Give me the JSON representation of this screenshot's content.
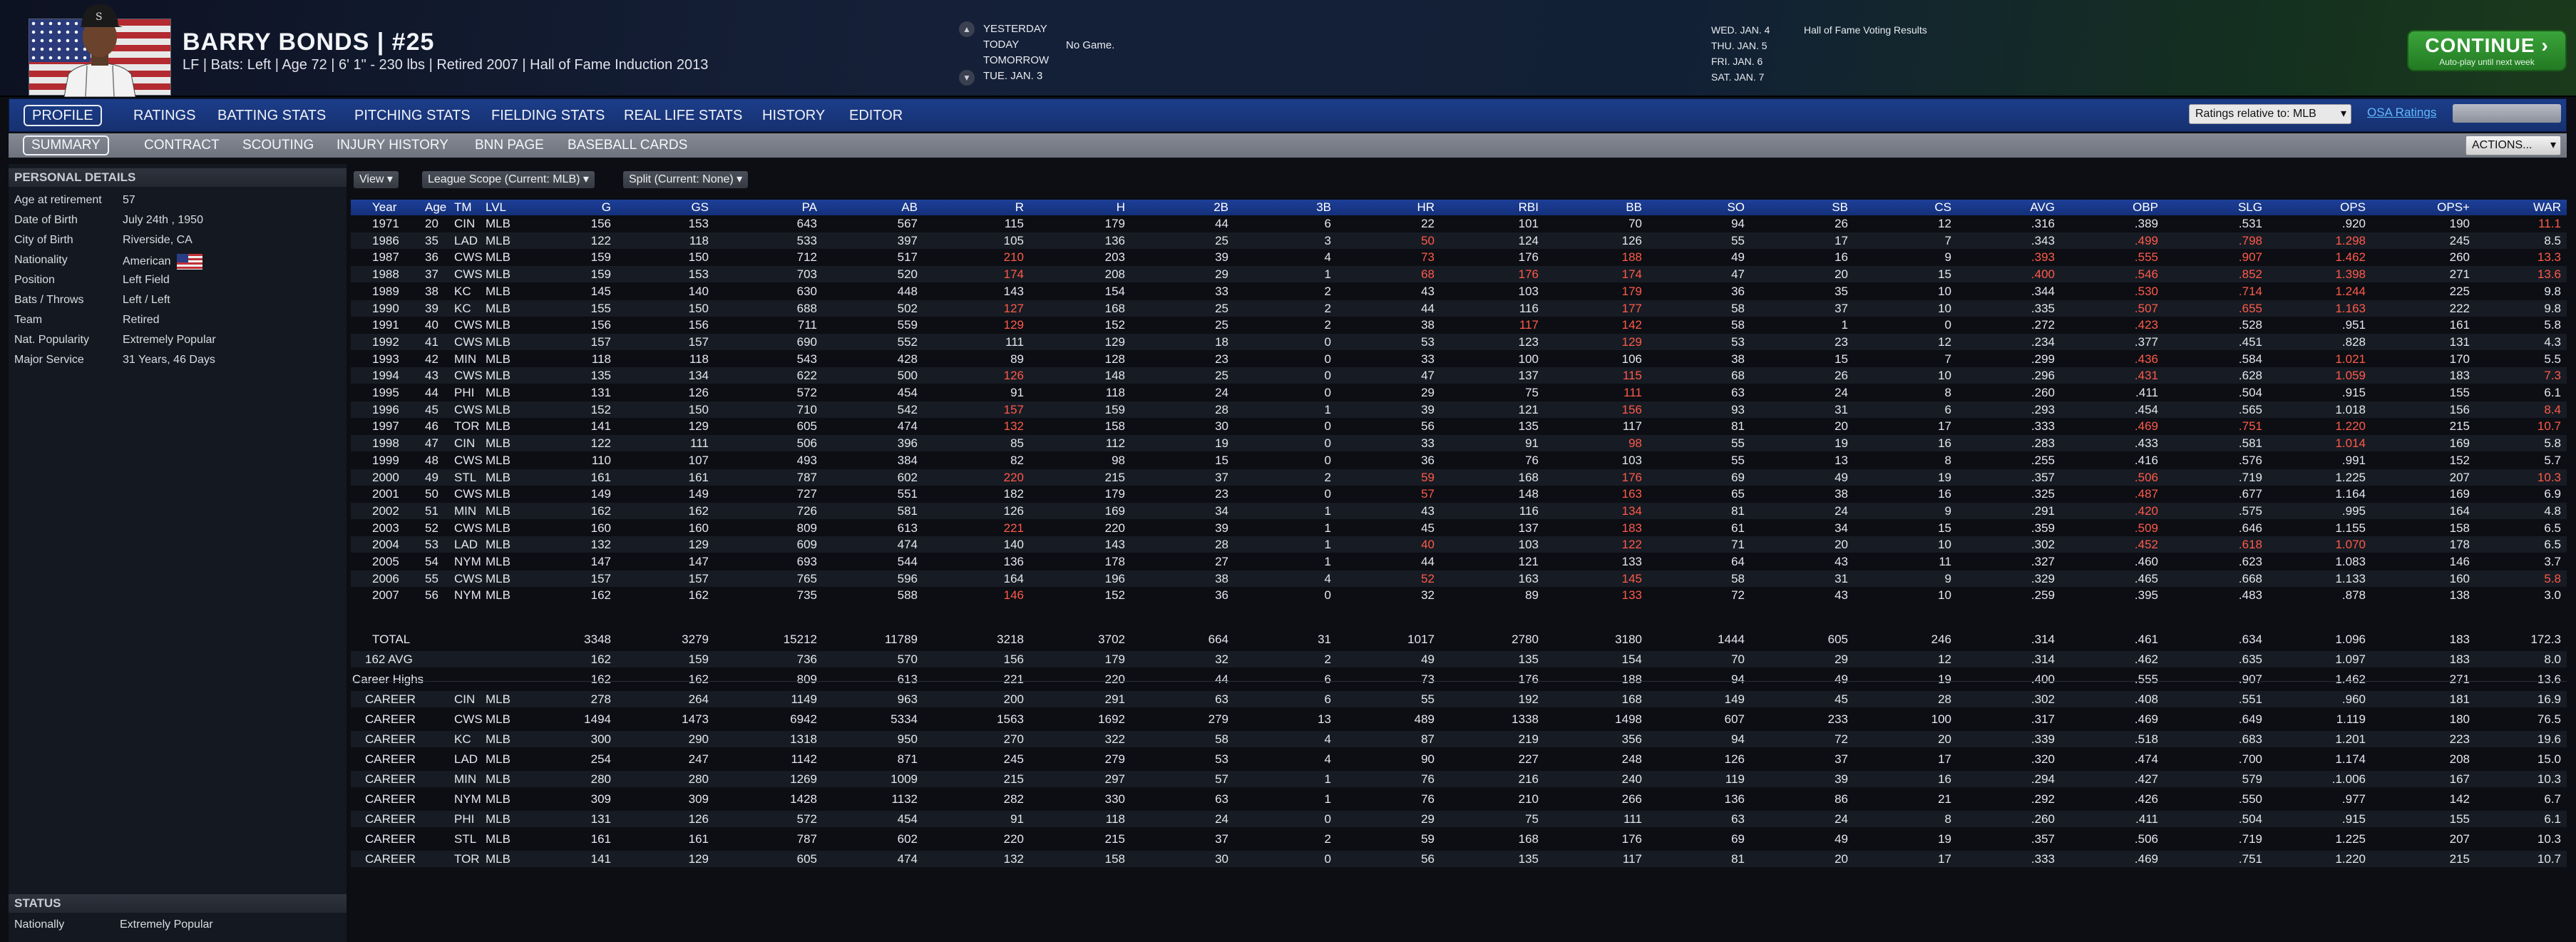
{
  "header": {
    "name_line": "BARRY BONDS  |  #25",
    "sub_line": "LF | Bats: Left  | Age 72  |  6' 1\" - 230 lbs  |  Retired 2007  |  Hall of Fame Induction 2013",
    "days": [
      "YESTERDAY",
      "TODAY",
      "TOMORROW",
      "TUE. JAN. 3"
    ],
    "no_game": "No Game.",
    "calendar": [
      "WED. JAN. 4",
      "THU. JAN. 5",
      "FRI. JAN. 6",
      "SAT. JAN. 7"
    ],
    "calendar_event": "Hall of Fame Voting Results",
    "continue_label": "CONTINUE",
    "continue_sub": "Auto-play until next week"
  },
  "main_nav": [
    "PROFILE",
    "RATINGS",
    "BATTING STATS",
    "PITCHING STATS",
    "FIELDING STATS",
    "REAL LIFE STATS",
    "HISTORY",
    "EDITOR"
  ],
  "ratings_relative": "Ratings relative to: MLB",
  "osa_label": "OSA Ratings",
  "sub_nav": [
    "SUMMARY",
    "CONTRACT",
    "SCOUTING",
    "INJURY HISTORY",
    "BNN PAGE",
    "BASEBALL CARDS"
  ],
  "actions_label": "ACTIONS...",
  "personal": {
    "title": "PERSONAL DETAILS",
    "rows": [
      {
        "k": "Age at retirement",
        "v": "57"
      },
      {
        "k": "Date of Birth",
        "v": "July 24th , 1950"
      },
      {
        "k": "City of Birth",
        "v": "Riverside, CA"
      },
      {
        "k": "Nationality",
        "v": "American"
      },
      {
        "k": "Position",
        "v": "Left Field"
      },
      {
        "k": "Bats / Throws",
        "v": "Left / Left"
      },
      {
        "k": "Team",
        "v": "Retired"
      },
      {
        "k": "Nat. Popularity",
        "v": "Extremely Popular"
      },
      {
        "k": "Major Service",
        "v": "31 Years, 46 Days"
      }
    ]
  },
  "status": {
    "title": "STATUS",
    "rows": [
      {
        "k": "Nationally",
        "v": "Extremely Popular"
      }
    ]
  },
  "filters": [
    "View",
    "League Scope (Current: MLB)",
    "Split  (Current: None)"
  ],
  "columns": [
    "Year",
    "Age",
    "TM",
    "LVL",
    "G",
    "GS",
    "PA",
    "AB",
    "R",
    "H",
    "2B",
    "3B",
    "HR",
    "RBI",
    "BB",
    "SO",
    "SB",
    "CS",
    "AVG",
    "OBP",
    "SLG",
    "OPS",
    "OPS+",
    "WAR"
  ],
  "seasons": [
    [
      "1971",
      "20",
      "CIN",
      "MLB",
      "156",
      "153",
      "643",
      "567",
      "115",
      "179",
      "44",
      "6",
      "22",
      "101",
      "70",
      "94",
      "26",
      "12",
      ".316",
      ".389",
      ".531",
      ".920",
      "190",
      "11.1"
    ],
    [
      "1986",
      "35",
      "LAD",
      "MLB",
      "122",
      "118",
      "533",
      "397",
      "105",
      "136",
      "25",
      "3",
      "50",
      "124",
      "126",
      "55",
      "17",
      "7",
      ".343",
      ".499",
      ".798",
      "1.298",
      "245",
      "8.5"
    ],
    [
      "1987",
      "36",
      "CWS",
      "MLB",
      "159",
      "150",
      "712",
      "517",
      "210",
      "203",
      "39",
      "4",
      "73",
      "176",
      "188",
      "49",
      "16",
      "9",
      ".393",
      ".555",
      ".907",
      "1.462",
      "260",
      "13.3"
    ],
    [
      "1988",
      "37",
      "CWS",
      "MLB",
      "159",
      "153",
      "703",
      "520",
      "174",
      "208",
      "29",
      "1",
      "68",
      "176",
      "174",
      "47",
      "20",
      "15",
      ".400",
      ".546",
      ".852",
      "1.398",
      "271",
      "13.6"
    ],
    [
      "1989",
      "38",
      "KC",
      "MLB",
      "145",
      "140",
      "630",
      "448",
      "143",
      "154",
      "33",
      "2",
      "43",
      "103",
      "179",
      "36",
      "35",
      "10",
      ".344",
      ".530",
      ".714",
      "1.244",
      "225",
      "9.8"
    ],
    [
      "1990",
      "39",
      "KC",
      "MLB",
      "155",
      "150",
      "688",
      "502",
      "127",
      "168",
      "25",
      "2",
      "44",
      "116",
      "177",
      "58",
      "37",
      "10",
      ".335",
      ".507",
      ".655",
      "1.163",
      "222",
      "9.8"
    ],
    [
      "1991",
      "40",
      "CWS",
      "MLB",
      "156",
      "156",
      "711",
      "559",
      "129",
      "152",
      "25",
      "2",
      "38",
      "117",
      "142",
      "58",
      "1",
      "0",
      ".272",
      ".423",
      ".528",
      ".951",
      "161",
      "5.8"
    ],
    [
      "1992",
      "41",
      "CWS",
      "MLB",
      "157",
      "157",
      "690",
      "552",
      "111",
      "129",
      "18",
      "0",
      "53",
      "123",
      "129",
      "53",
      "23",
      "12",
      ".234",
      ".377",
      ".451",
      ".828",
      "131",
      "4.3"
    ],
    [
      "1993",
      "42",
      "MIN",
      "MLB",
      "118",
      "118",
      "543",
      "428",
      "89",
      "128",
      "23",
      "0",
      "33",
      "100",
      "106",
      "38",
      "15",
      "7",
      ".299",
      ".436",
      ".584",
      "1.021",
      "170",
      "5.5"
    ],
    [
      "1994",
      "43",
      "CWS",
      "MLB",
      "135",
      "134",
      "622",
      "500",
      "126",
      "148",
      "25",
      "0",
      "47",
      "137",
      "115",
      "68",
      "26",
      "10",
      ".296",
      ".431",
      ".628",
      "1.059",
      "183",
      "7.3"
    ],
    [
      "1995",
      "44",
      "PHI",
      "MLB",
      "131",
      "126",
      "572",
      "454",
      "91",
      "118",
      "24",
      "0",
      "29",
      "75",
      "111",
      "63",
      "24",
      "8",
      ".260",
      ".411",
      ".504",
      ".915",
      "155",
      "6.1"
    ],
    [
      "1996",
      "45",
      "CWS",
      "MLB",
      "152",
      "150",
      "710",
      "542",
      "157",
      "159",
      "28",
      "1",
      "39",
      "121",
      "156",
      "93",
      "31",
      "6",
      ".293",
      ".454",
      ".565",
      "1.018",
      "156",
      "8.4"
    ],
    [
      "1997",
      "46",
      "TOR",
      "MLB",
      "141",
      "129",
      "605",
      "474",
      "132",
      "158",
      "30",
      "0",
      "56",
      "135",
      "117",
      "81",
      "20",
      "17",
      ".333",
      ".469",
      ".751",
      "1.220",
      "215",
      "10.7"
    ],
    [
      "1998",
      "47",
      "CIN",
      "MLB",
      "122",
      "111",
      "506",
      "396",
      "85",
      "112",
      "19",
      "0",
      "33",
      "91",
      "98",
      "55",
      "19",
      "16",
      ".283",
      ".433",
      ".581",
      "1.014",
      "169",
      "5.8"
    ],
    [
      "1999",
      "48",
      "CWS",
      "MLB",
      "110",
      "107",
      "493",
      "384",
      "82",
      "98",
      "15",
      "0",
      "36",
      "76",
      "103",
      "55",
      "13",
      "8",
      ".255",
      ".416",
      ".576",
      ".991",
      "152",
      "5.7"
    ],
    [
      "2000",
      "49",
      "STL",
      "MLB",
      "161",
      "161",
      "787",
      "602",
      "220",
      "215",
      "37",
      "2",
      "59",
      "168",
      "176",
      "69",
      "49",
      "19",
      ".357",
      ".506",
      ".719",
      "1.225",
      "207",
      "10.3"
    ],
    [
      "2001",
      "50",
      "CWS",
      "MLB",
      "149",
      "149",
      "727",
      "551",
      "182",
      "179",
      "23",
      "0",
      "57",
      "148",
      "163",
      "65",
      "38",
      "16",
      ".325",
      ".487",
      ".677",
      "1.164",
      "169",
      "6.9"
    ],
    [
      "2002",
      "51",
      "MIN",
      "MLB",
      "162",
      "162",
      "726",
      "581",
      "126",
      "169",
      "34",
      "1",
      "43",
      "116",
      "134",
      "81",
      "24",
      "9",
      ".291",
      ".420",
      ".575",
      ".995",
      "164",
      "4.8"
    ],
    [
      "2003",
      "52",
      "CWS",
      "MLB",
      "160",
      "160",
      "809",
      "613",
      "221",
      "220",
      "39",
      "1",
      "45",
      "137",
      "183",
      "61",
      "34",
      "15",
      ".359",
      ".509",
      ".646",
      "1.155",
      "158",
      "6.5"
    ],
    [
      "2004",
      "53",
      "LAD",
      "MLB",
      "132",
      "129",
      "609",
      "474",
      "140",
      "143",
      "28",
      "1",
      "40",
      "103",
      "122",
      "71",
      "20",
      "10",
      ".302",
      ".452",
      ".618",
      "1.070",
      "178",
      "6.5"
    ],
    [
      "2005",
      "54",
      "NYM",
      "MLB",
      "147",
      "147",
      "693",
      "544",
      "136",
      "178",
      "27",
      "1",
      "44",
      "121",
      "133",
      "64",
      "43",
      "11",
      ".327",
      ".460",
      ".623",
      "1.083",
      "146",
      "3.7"
    ],
    [
      "2006",
      "55",
      "CWS",
      "MLB",
      "157",
      "157",
      "765",
      "596",
      "164",
      "196",
      "38",
      "4",
      "52",
      "163",
      "145",
      "58",
      "31",
      "9",
      ".329",
      ".465",
      ".668",
      "1.133",
      "160",
      "5.8"
    ],
    [
      "2007",
      "56",
      "NYM",
      "MLB",
      "162",
      "162",
      "735",
      "588",
      "146",
      "152",
      "36",
      "0",
      "32",
      "89",
      "133",
      "72",
      "43",
      "10",
      ".259",
      ".395",
      ".483",
      ".878",
      "138",
      "3.0"
    ]
  ],
  "totals": [
    [
      "TOTAL",
      "",
      "",
      "",
      "3348",
      "3279",
      "15212",
      "11789",
      "3218",
      "3702",
      "664",
      "31",
      "1017",
      "2780",
      "3180",
      "1444",
      "605",
      "246",
      ".314",
      ".461",
      ".634",
      "1.096",
      "183",
      "172.3"
    ],
    [
      "162 AVG",
      "",
      "",
      "",
      "162",
      "159",
      "736",
      "570",
      "156",
      "179",
      "32",
      "2",
      "49",
      "135",
      "154",
      "70",
      "29",
      "12",
      ".314",
      ".462",
      ".635",
      "1.097",
      "183",
      "8.0"
    ],
    [
      "Career Highs",
      "",
      "",
      "",
      "162",
      "162",
      "809",
      "613",
      "221",
      "220",
      "44",
      "6",
      "73",
      "176",
      "188",
      "94",
      "49",
      "19",
      ".400",
      ".555",
      ".907",
      "1.462",
      "271",
      "13.6"
    ],
    [
      "CAREER",
      "",
      "CIN",
      "MLB",
      "278",
      "264",
      "1149",
      "963",
      "200",
      "291",
      "63",
      "6",
      "55",
      "192",
      "168",
      "149",
      "45",
      "28",
      ".302",
      ".408",
      ".551",
      ".960",
      "181",
      "16.9"
    ],
    [
      "CAREER",
      "",
      "CWS",
      "MLB",
      "1494",
      "1473",
      "6942",
      "5334",
      "1563",
      "1692",
      "279",
      "13",
      "489",
      "1338",
      "1498",
      "607",
      "233",
      "100",
      ".317",
      ".469",
      ".649",
      "1.119",
      "180",
      "76.5"
    ],
    [
      "CAREER",
      "",
      "KC",
      "MLB",
      "300",
      "290",
      "1318",
      "950",
      "270",
      "322",
      "58",
      "4",
      "87",
      "219",
      "356",
      "94",
      "72",
      "20",
      ".339",
      ".518",
      ".683",
      "1.201",
      "223",
      "19.6"
    ],
    [
      "CAREER",
      "",
      "LAD",
      "MLB",
      "254",
      "247",
      "1142",
      "871",
      "245",
      "279",
      "53",
      "4",
      "90",
      "227",
      "248",
      "126",
      "37",
      "17",
      ".320",
      ".474",
      ".700",
      "1.174",
      "208",
      "15.0"
    ],
    [
      "CAREER",
      "",
      "MIN",
      "MLB",
      "280",
      "280",
      "1269",
      "1009",
      "215",
      "297",
      "57",
      "1",
      "76",
      "216",
      "240",
      "119",
      "39",
      "16",
      ".294",
      ".427",
      "579",
      ".1.006",
      "167",
      "10.3"
    ],
    [
      "CAREER",
      "",
      "NYM",
      "MLB",
      "309",
      "309",
      "1428",
      "1132",
      "282",
      "330",
      "63",
      "1",
      "76",
      "210",
      "266",
      "136",
      "86",
      "21",
      ".292",
      ".426",
      ".550",
      ".977",
      "142",
      "6.7"
    ],
    [
      "CAREER",
      "",
      "PHI",
      "MLB",
      "131",
      "126",
      "572",
      "454",
      "91",
      "118",
      "24",
      "0",
      "29",
      "75",
      "111",
      "63",
      "24",
      "8",
      ".260",
      ".411",
      ".504",
      ".915",
      "155",
      "6.1"
    ],
    [
      "CAREER",
      "",
      "STL",
      "MLB",
      "161",
      "161",
      "787",
      "602",
      "220",
      "215",
      "37",
      "2",
      "59",
      "168",
      "176",
      "69",
      "49",
      "19",
      ".357",
      ".506",
      ".719",
      "1.225",
      "207",
      "10.3"
    ],
    [
      "CAREER",
      "",
      "TOR",
      "MLB",
      "141",
      "129",
      "605",
      "474",
      "132",
      "158",
      "30",
      "0",
      "56",
      "135",
      "117",
      "81",
      "20",
      "17",
      ".333",
      ".469",
      ".751",
      "1.220",
      "215",
      "10.7"
    ]
  ],
  "highlights": [
    [
      0,
      23
    ],
    [
      1,
      12
    ],
    [
      1,
      19
    ],
    [
      1,
      20
    ],
    [
      1,
      21
    ],
    [
      2,
      8
    ],
    [
      2,
      12
    ],
    [
      2,
      14
    ],
    [
      2,
      18
    ],
    [
      2,
      19
    ],
    [
      2,
      20
    ],
    [
      2,
      21
    ],
    [
      2,
      23
    ],
    [
      3,
      8
    ],
    [
      3,
      12
    ],
    [
      3,
      13
    ],
    [
      3,
      14
    ],
    [
      3,
      18
    ],
    [
      3,
      19
    ],
    [
      3,
      20
    ],
    [
      3,
      21
    ],
    [
      3,
      23
    ],
    [
      4,
      14
    ],
    [
      4,
      19
    ],
    [
      4,
      20
    ],
    [
      4,
      21
    ],
    [
      5,
      8
    ],
    [
      5,
      14
    ],
    [
      5,
      19
    ],
    [
      5,
      20
    ],
    [
      5,
      21
    ],
    [
      6,
      8
    ],
    [
      6,
      13
    ],
    [
      6,
      14
    ],
    [
      6,
      19
    ],
    [
      7,
      14
    ],
    [
      8,
      19
    ],
    [
      8,
      21
    ],
    [
      9,
      8
    ],
    [
      9,
      14
    ],
    [
      9,
      19
    ],
    [
      9,
      21
    ],
    [
      9,
      23
    ],
    [
      10,
      14
    ],
    [
      11,
      8
    ],
    [
      11,
      14
    ],
    [
      11,
      23
    ],
    [
      12,
      8
    ],
    [
      12,
      19
    ],
    [
      12,
      20
    ],
    [
      12,
      21
    ],
    [
      12,
      23
    ],
    [
      13,
      14
    ],
    [
      13,
      21
    ],
    [
      15,
      8
    ],
    [
      15,
      12
    ],
    [
      15,
      14
    ],
    [
      15,
      19
    ],
    [
      15,
      23
    ],
    [
      16,
      12
    ],
    [
      16,
      14
    ],
    [
      16,
      19
    ],
    [
      17,
      14
    ],
    [
      17,
      19
    ],
    [
      18,
      8
    ],
    [
      18,
      14
    ],
    [
      18,
      19
    ],
    [
      19,
      12
    ],
    [
      19,
      14
    ],
    [
      19,
      19
    ],
    [
      19,
      20
    ],
    [
      19,
      21
    ],
    [
      21,
      12
    ],
    [
      21,
      14
    ],
    [
      21,
      23
    ],
    [
      22,
      8
    ],
    [
      22,
      14
    ]
  ]
}
